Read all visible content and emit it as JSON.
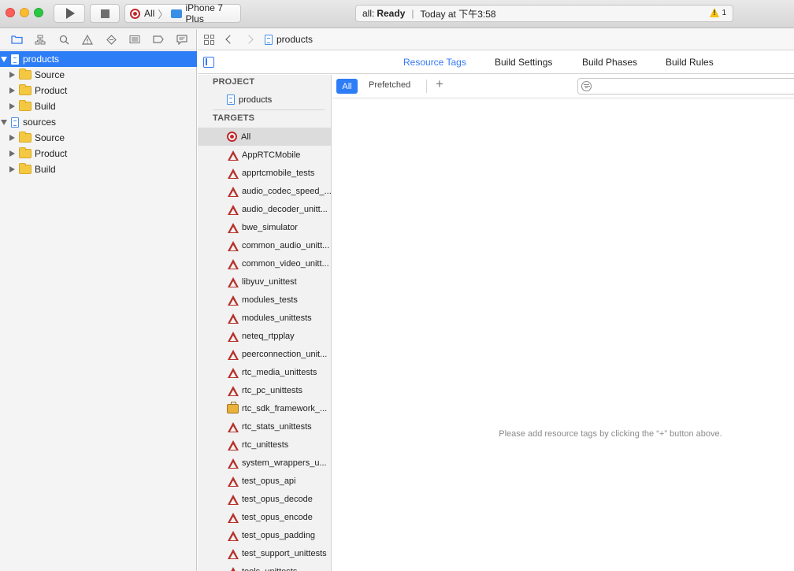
{
  "toolbar": {
    "scheme_target": "All",
    "scheme_separator": "〉",
    "device": "iPhone 7 Plus",
    "activity_prefix": "all:",
    "activity_status": "Ready",
    "activity_separator": "|",
    "activity_time": "Today at 下午3:58",
    "warning_count": "1"
  },
  "navigator": {
    "tabs": [
      "folder-icon",
      "hierarchy-icon",
      "search-icon",
      "warning-icon",
      "diamond-icon",
      "list-icon",
      "tag-icon",
      "comment-icon"
    ],
    "items": [
      {
        "label": "products",
        "type": "project",
        "open": true,
        "selected": true
      },
      {
        "label": "Source",
        "type": "folder"
      },
      {
        "label": "Product",
        "type": "folder"
      },
      {
        "label": "Build",
        "type": "folder"
      },
      {
        "label": "sources",
        "type": "project",
        "open": true
      },
      {
        "label": "Source",
        "type": "folder"
      },
      {
        "label": "Product",
        "type": "folder"
      },
      {
        "label": "Build",
        "type": "folder"
      }
    ]
  },
  "jumpbar": {
    "current": "products"
  },
  "editor_tabs": {
    "resource_tags": "Resource Tags",
    "build_settings": "Build Settings",
    "build_phases": "Build Phases",
    "build_rules": "Build Rules"
  },
  "targets_panel": {
    "project_header": "PROJECT",
    "project_name": "products",
    "targets_header": "TARGETS",
    "targets": [
      {
        "label": "All",
        "icon": "target"
      },
      {
        "label": "AppRTCMobile",
        "icon": "app"
      },
      {
        "label": "apprtcmobile_tests",
        "icon": "app"
      },
      {
        "label": "audio_codec_speed_...",
        "icon": "app"
      },
      {
        "label": "audio_decoder_unitt...",
        "icon": "app"
      },
      {
        "label": "bwe_simulator",
        "icon": "app"
      },
      {
        "label": "common_audio_unitt...",
        "icon": "app"
      },
      {
        "label": "common_video_unitt...",
        "icon": "app"
      },
      {
        "label": "libyuv_unittest",
        "icon": "app"
      },
      {
        "label": "modules_tests",
        "icon": "app"
      },
      {
        "label": "modules_unittests",
        "icon": "app"
      },
      {
        "label": "neteq_rtpplay",
        "icon": "app"
      },
      {
        "label": "peerconnection_unit...",
        "icon": "app"
      },
      {
        "label": "rtc_media_unittests",
        "icon": "app"
      },
      {
        "label": "rtc_pc_unittests",
        "icon": "app"
      },
      {
        "label": "rtc_sdk_framework_...",
        "icon": "framework"
      },
      {
        "label": "rtc_stats_unittests",
        "icon": "app"
      },
      {
        "label": "rtc_unittests",
        "icon": "app"
      },
      {
        "label": "system_wrappers_u...",
        "icon": "app"
      },
      {
        "label": "test_opus_api",
        "icon": "app"
      },
      {
        "label": "test_opus_decode",
        "icon": "app"
      },
      {
        "label": "test_opus_encode",
        "icon": "app"
      },
      {
        "label": "test_opus_padding",
        "icon": "app"
      },
      {
        "label": "test_support_unittests",
        "icon": "app"
      },
      {
        "label": "tools_unittests",
        "icon": "app"
      }
    ]
  },
  "filter": {
    "all_label": "All",
    "prefetched_label": "Prefetched",
    "add_label": "+",
    "search_placeholder": ""
  },
  "content": {
    "empty_message": "Please add resource tags by clicking the “+” button above."
  }
}
